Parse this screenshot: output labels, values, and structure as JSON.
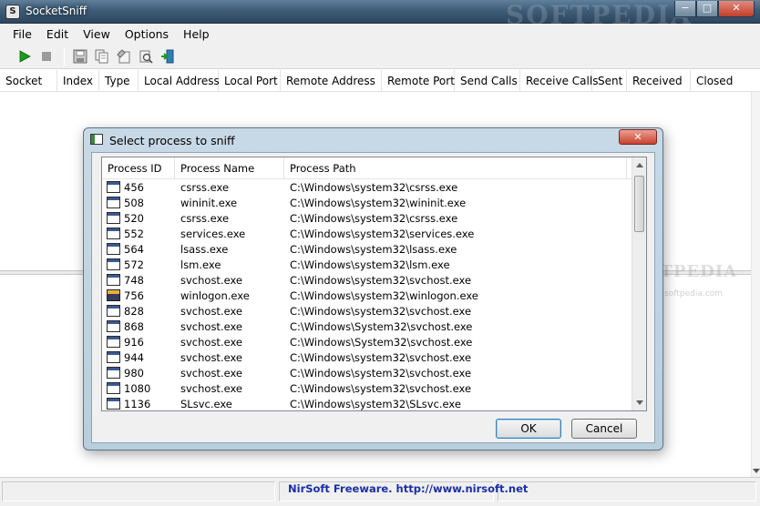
{
  "window": {
    "title": "SocketSniff",
    "watermark": "SOFTPEDIA",
    "controls": {
      "minimize": "−",
      "maximize": "□",
      "close": "✕"
    }
  },
  "menu": [
    "File",
    "Edit",
    "View",
    "Options",
    "Help"
  ],
  "toolbar": {
    "icons": [
      "play-icon",
      "stop-icon",
      "save-icon",
      "copy-icon",
      "properties-icon",
      "find-icon",
      "exit-icon"
    ]
  },
  "columns": [
    {
      "label": "Socket"
    },
    {
      "label": "Index"
    },
    {
      "label": "Type"
    },
    {
      "label": "Local Address"
    },
    {
      "label": "Local Port"
    },
    {
      "label": "Remote Address"
    },
    {
      "label": "Remote Port"
    },
    {
      "label": "Send Calls"
    },
    {
      "label": "Receive Calls"
    },
    {
      "label": "Sent"
    },
    {
      "label": "Received"
    },
    {
      "label": "Closed"
    }
  ],
  "pane_watermark": {
    "text": "SOFTPEDIA",
    "sub": "www.softpedia.com"
  },
  "status": {
    "text": "NirSoft Freeware.  http://www.nirsoft.net"
  },
  "dialog": {
    "title": "Select process to sniff",
    "close_label": "✕",
    "headers": {
      "id": "Process ID",
      "name": "Process Name",
      "path": "Process Path"
    },
    "rows": [
      {
        "id": "456",
        "name": "csrss.exe",
        "path": "C:\\Windows\\system32\\csrss.exe",
        "icon": "window"
      },
      {
        "id": "508",
        "name": "wininit.exe",
        "path": "C:\\Windows\\system32\\wininit.exe",
        "icon": "window"
      },
      {
        "id": "520",
        "name": "csrss.exe",
        "path": "C:\\Windows\\system32\\csrss.exe",
        "icon": "window"
      },
      {
        "id": "552",
        "name": "services.exe",
        "path": "C:\\Windows\\system32\\services.exe",
        "icon": "window"
      },
      {
        "id": "564",
        "name": "lsass.exe",
        "path": "C:\\Windows\\system32\\lsass.exe",
        "icon": "window"
      },
      {
        "id": "572",
        "name": "lsm.exe",
        "path": "C:\\Windows\\system32\\lsm.exe",
        "icon": "window"
      },
      {
        "id": "748",
        "name": "svchost.exe",
        "path": "C:\\Windows\\system32\\svchost.exe",
        "icon": "window"
      },
      {
        "id": "756",
        "name": "winlogon.exe",
        "path": "C:\\Windows\\system32\\winlogon.exe",
        "icon": "winlogon"
      },
      {
        "id": "828",
        "name": "svchost.exe",
        "path": "C:\\Windows\\system32\\svchost.exe",
        "icon": "window"
      },
      {
        "id": "868",
        "name": "svchost.exe",
        "path": "C:\\Windows\\System32\\svchost.exe",
        "icon": "window"
      },
      {
        "id": "916",
        "name": "svchost.exe",
        "path": "C:\\Windows\\System32\\svchost.exe",
        "icon": "window"
      },
      {
        "id": "944",
        "name": "svchost.exe",
        "path": "C:\\Windows\\system32\\svchost.exe",
        "icon": "window"
      },
      {
        "id": "980",
        "name": "svchost.exe",
        "path": "C:\\Windows\\system32\\svchost.exe",
        "icon": "window"
      },
      {
        "id": "1080",
        "name": "svchost.exe",
        "path": "C:\\Windows\\system32\\svchost.exe",
        "icon": "window"
      },
      {
        "id": "1136",
        "name": "SLsvc.exe",
        "path": "C:\\Windows\\system32\\SLsvc.exe",
        "icon": "window"
      }
    ],
    "ok_label": "OK",
    "cancel_label": "Cancel"
  }
}
